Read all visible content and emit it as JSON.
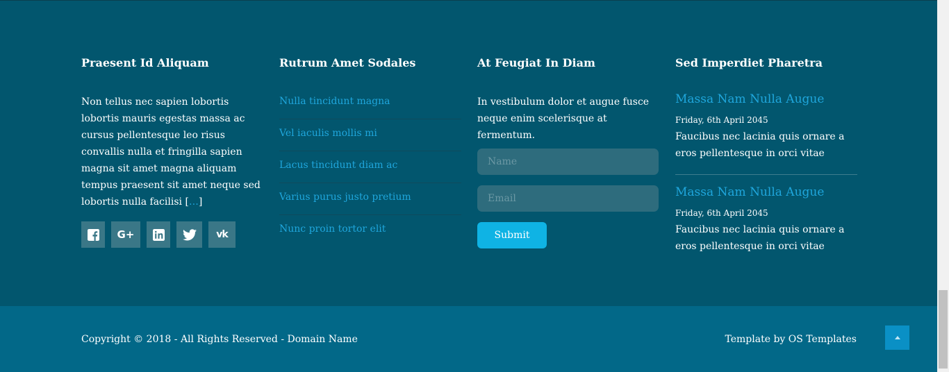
{
  "col1": {
    "heading": "Praesent Id Aliquam",
    "text": "Non tellus nec sapien lobortis lobortis mauris egestas massa ac cursus pellentesque leo risus convallis nulla et fringilla sapien magna sit amet magna aliquam tempus praesent sit amet neque sed lobortis nulla facilisi ",
    "more_open": "[",
    "more": "…",
    "more_close": "]",
    "social": [
      "facebook-icon",
      "google-plus-icon",
      "linkedin-icon",
      "twitter-icon",
      "vk-icon"
    ]
  },
  "col2": {
    "heading": "Rutrum Amet Sodales",
    "links": [
      "Nulla tincidunt magna",
      "Vel iaculis mollis mi",
      "Lacus tincidunt diam ac",
      "Varius purus justo pretium",
      "Nunc proin tortor elit"
    ]
  },
  "col3": {
    "heading": "At Feugiat In Diam",
    "text": "In vestibulum dolor et augue fusce neque enim scelerisque at fermentum.",
    "name_placeholder": "Name",
    "email_placeholder": "Email",
    "submit": "Submit"
  },
  "col4": {
    "heading": "Sed Imperdiet Pharetra",
    "posts": [
      {
        "title": "Massa Nam Nulla Augue",
        "date": "Friday, 6th April 2045",
        "text": "Faucibus nec lacinia quis ornare a eros pellentesque in orci vitae"
      },
      {
        "title": "Massa Nam Nulla Augue",
        "date": "Friday, 6th April 2045",
        "text": "Faucibus nec lacinia quis ornare a eros pellentesque in orci vitae"
      }
    ]
  },
  "bottom": {
    "copyright": "Copyright © 2018 - All Rights Reserved - Domain Name",
    "credit": "Template by OS Templates",
    "scroll_top_icon": "chevron-up-icon"
  },
  "colors": {
    "footer_bg": "#02566e",
    "bottom_bg": "#026888",
    "link": "#1fa6dc",
    "accent": "#0fb3e4"
  }
}
